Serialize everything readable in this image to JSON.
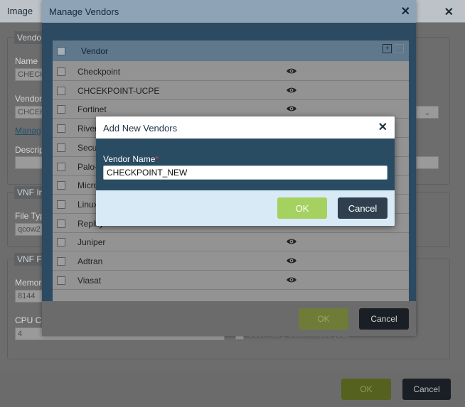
{
  "image_dialog": {
    "title": "Image",
    "close_icon": "close-icon",
    "section_vendor": "Vendo",
    "name_label": "Name",
    "name_value": "CHECK",
    "vendor_label": "Vendor",
    "vendor_value": "CHCEK",
    "manage_link": "Manag",
    "description_label": "Descrip",
    "section_vnf_image": "VNF Im",
    "file_type_label": "File Typ",
    "file_type_value": "qcow2",
    "section_vnf_flavor": "VNF Fl",
    "memory_label": "Memor",
    "memory_value": "8144",
    "cpu_label": "CPU Co",
    "cpu_value": "4",
    "checkbox_label": "Secondary Subinterface (SE)",
    "ok_label": "OK",
    "cancel_label": "Cancel"
  },
  "manage_vendors": {
    "title": "Manage Vendors",
    "column_vendor": "Vendor",
    "add_icon": "plus-icon",
    "remove_icon": "minus-icon",
    "eye_icon": "eye-icon",
    "vendors": [
      "Checkpoint",
      "CHCEKPOINT-UCPE",
      "Fortinet",
      "Riverbed",
      "Security",
      "Palo-Alto",
      "Microsoft",
      "Linux",
      "Replify",
      "Juniper",
      "Adtran",
      "Viasat"
    ],
    "ok_label": "OK",
    "cancel_label": "Cancel"
  },
  "add_vendor": {
    "title": "Add New Vendors",
    "vendor_name_label": "Vendor Name",
    "required_marker": "*",
    "vendor_name_value": "CHECKPOINT_NEW",
    "ok_label": "OK",
    "cancel_label": "Cancel"
  }
}
